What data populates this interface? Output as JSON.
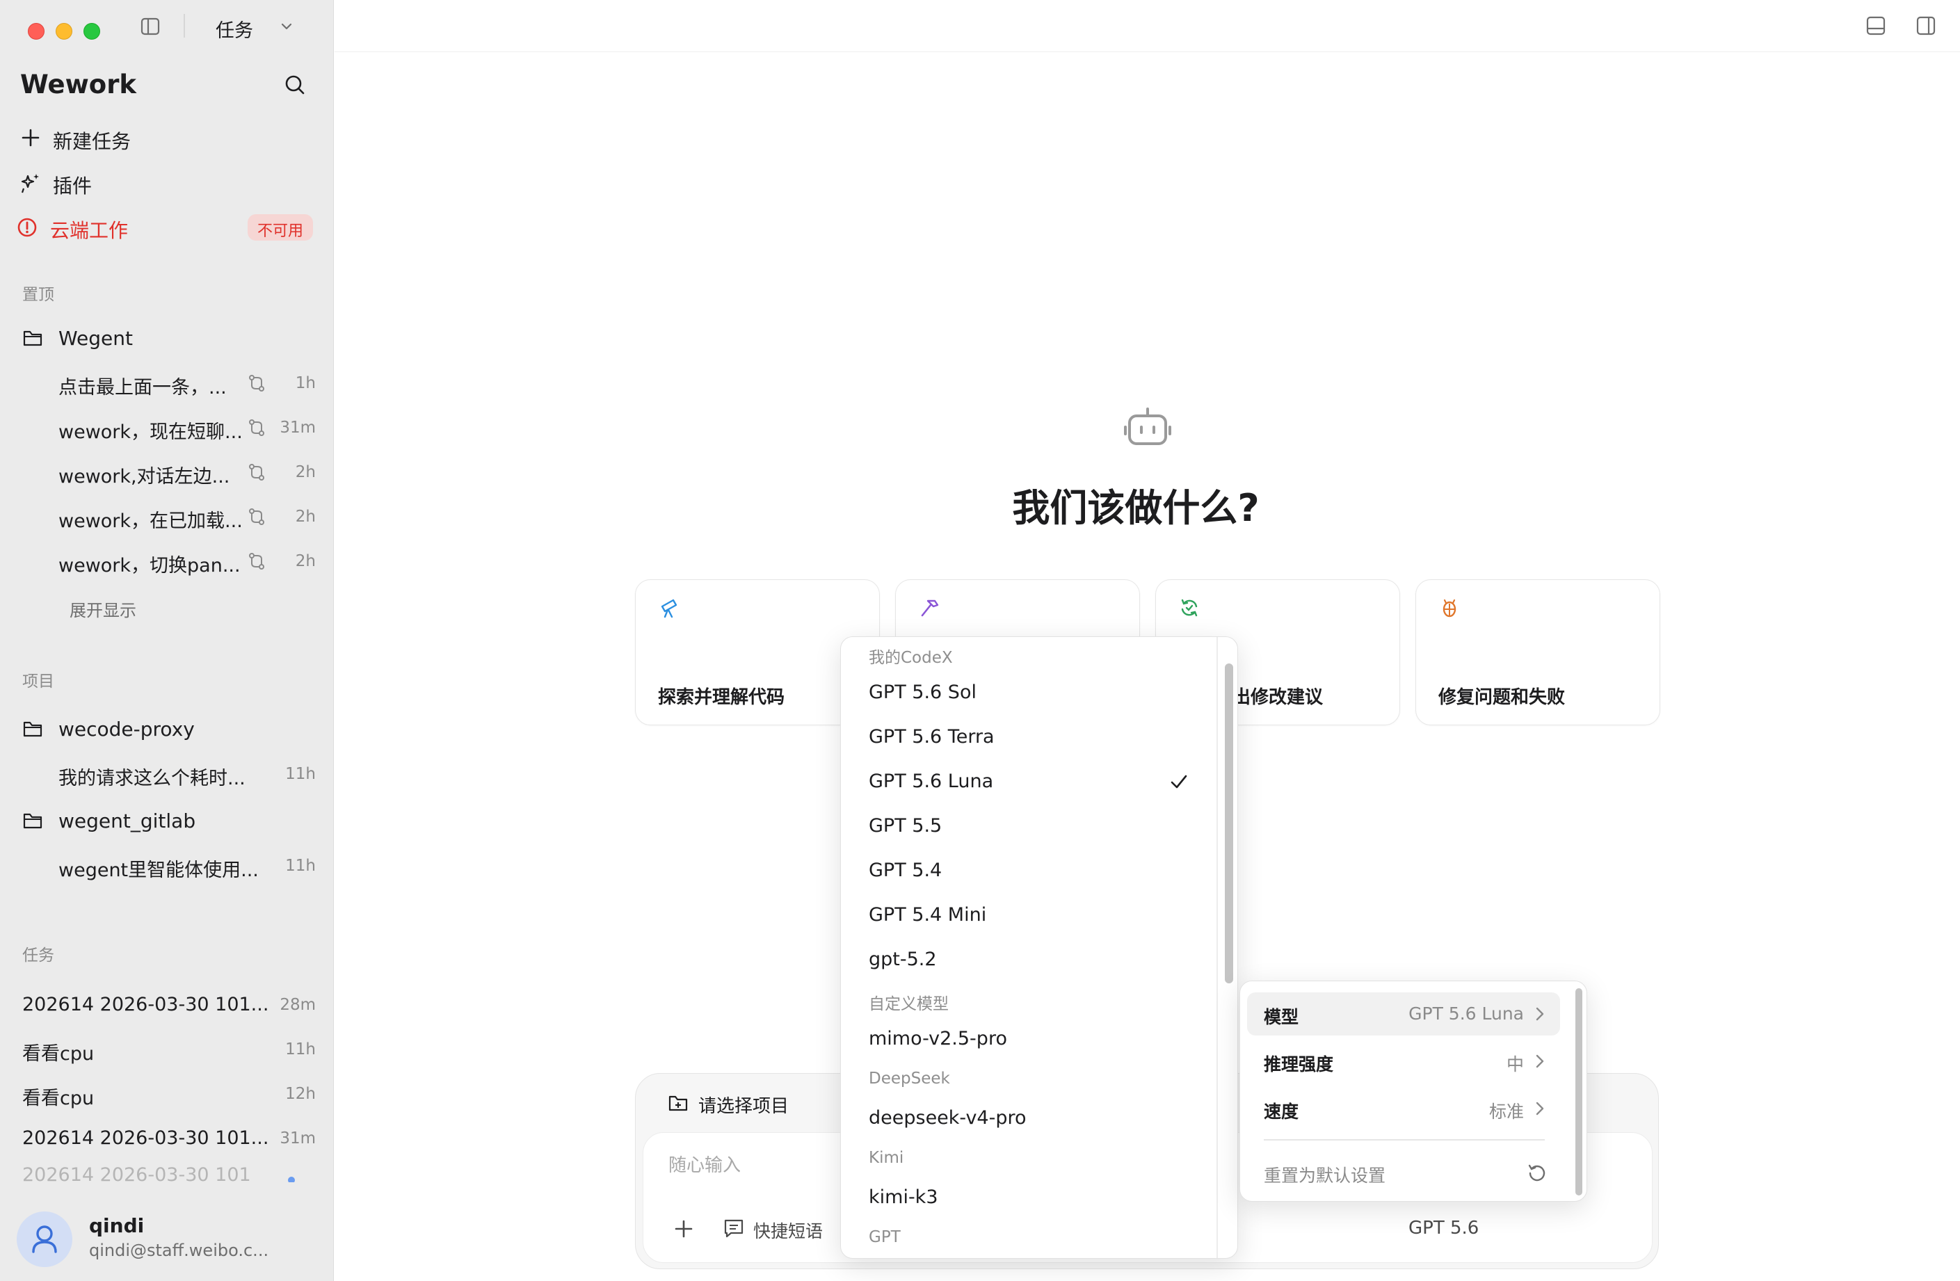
{
  "window": {
    "view_selector": "任务"
  },
  "sidebar": {
    "app_name": "Wework",
    "nav": {
      "new_task": "新建任务",
      "plugins": "插件",
      "cloud_work": "云端工作",
      "cloud_badge": "不可用"
    },
    "pinned": {
      "label": "置顶",
      "folder": "Wegent",
      "items": [
        {
          "title": "点击最上面一条，...",
          "time": "1h"
        },
        {
          "title": "wework，现在短聊...",
          "time": "31m"
        },
        {
          "title": "wework,对话左边...",
          "time": "2h"
        },
        {
          "title": "wework，在已加载...",
          "time": "2h"
        },
        {
          "title": "wework，切换pan...",
          "time": "2h"
        }
      ],
      "expand": "展开显示"
    },
    "projects": {
      "label": "项目",
      "groups": [
        {
          "folder": "wecode-proxy",
          "item": "我的请求这么个耗时...",
          "time": "11h"
        },
        {
          "folder": "wegent_gitlab",
          "item": "wegent里智能体使用...",
          "time": "11h"
        }
      ]
    },
    "tasks": {
      "label": "任务",
      "items": [
        {
          "title": "202614 2026-03-30 101...",
          "time": "28m"
        },
        {
          "title": "看看cpu",
          "time": "11h"
        },
        {
          "title": "看看cpu",
          "time": "12h"
        },
        {
          "title": "202614 2026-03-30 101...",
          "time": "31m"
        },
        {
          "title": "202614 2026-03-30 101"
        }
      ]
    },
    "user": {
      "name": "qindi",
      "email": "qindi@staff.weibo.c..."
    }
  },
  "main": {
    "heading": "我们该做什么?",
    "cards": [
      {
        "label": "探索并理解代码",
        "icon": "telescope-icon",
        "color": "#2b8fe0"
      },
      {
        "label": "",
        "icon": "hammer-icon",
        "color": "#8a55d6"
      },
      {
        "label": "码并提出修改建议",
        "icon": "refresh-icon",
        "color": "#2fa35c"
      },
      {
        "label": "修复问题和失败",
        "icon": "bug-icon",
        "color": "#e0762b"
      }
    ],
    "composer": {
      "project_select": "请选择项目",
      "placeholder": "随心输入",
      "quick_phrases": "快捷短语",
      "model_label": "GPT 5.6"
    }
  },
  "model_menu": {
    "groups": [
      {
        "label": "我的CodeX",
        "items": [
          "GPT 5.6 Sol",
          "GPT 5.6 Terra",
          "GPT 5.6 Luna",
          "GPT 5.5",
          "GPT 5.4",
          "GPT 5.4 Mini",
          "gpt-5.2"
        ]
      },
      {
        "label": "自定义模型",
        "items": [
          "mimo-v2.5-pro"
        ]
      },
      {
        "label": "DeepSeek",
        "items": [
          "deepseek-v4-pro"
        ]
      },
      {
        "label": "Kimi",
        "items": [
          "kimi-k3"
        ]
      },
      {
        "label": "GPT",
        "items": []
      }
    ],
    "selected": "GPT 5.6 Luna"
  },
  "settings_popover": {
    "model": {
      "label": "模型",
      "value": "GPT 5.6 Luna"
    },
    "reasoning": {
      "label": "推理强度",
      "value": "中"
    },
    "speed": {
      "label": "速度",
      "value": "标准"
    },
    "reset": "重置为默认设置"
  },
  "colors": {
    "sidebar_bg": "#ebebeb",
    "danger": "#e0312b",
    "badge_bg": "#f6d6d4",
    "accent_avatar": "#3a6fd8"
  }
}
